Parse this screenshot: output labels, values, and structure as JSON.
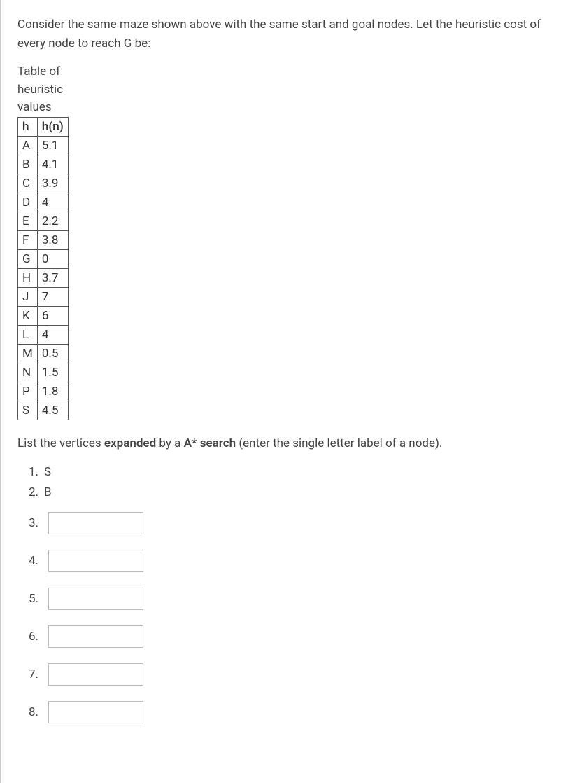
{
  "intro": "Consider the same maze shown above with the same start and goal nodes. Let the heuristic cost of every node to reach G be:",
  "table": {
    "caption": "Table of heuristic values",
    "headers": {
      "h": "h",
      "hn": "h(n)"
    },
    "rows": [
      {
        "h": "A",
        "hn": "5.1"
      },
      {
        "h": "B",
        "hn": "4.1"
      },
      {
        "h": "C",
        "hn": "3.9"
      },
      {
        "h": "D",
        "hn": "4"
      },
      {
        "h": "E",
        "hn": "2.2"
      },
      {
        "h": "F",
        "hn": "3.8"
      },
      {
        "h": "G",
        "hn": "0"
      },
      {
        "h": "H",
        "hn": "3.7"
      },
      {
        "h": "J",
        "hn": "7"
      },
      {
        "h": "K",
        "hn": "6"
      },
      {
        "h": "L",
        "hn": "4"
      },
      {
        "h": "M",
        "hn": "0.5"
      },
      {
        "h": "N",
        "hn": "1.5"
      },
      {
        "h": "P",
        "hn": "1.8"
      },
      {
        "h": "S",
        "hn": "4.5"
      }
    ]
  },
  "instruction": {
    "pre": "List the vertices ",
    "bold1": "expanded",
    "mid": " by a ",
    "bold2": "A* search",
    "post": " (enter the single letter label of a node)."
  },
  "answers": {
    "given": [
      {
        "num": "1.",
        "val": "S"
      },
      {
        "num": "2.",
        "val": "B"
      }
    ],
    "inputs": [
      {
        "num": "3."
      },
      {
        "num": "4."
      },
      {
        "num": "5."
      },
      {
        "num": "6."
      },
      {
        "num": "7."
      },
      {
        "num": "8."
      }
    ]
  }
}
